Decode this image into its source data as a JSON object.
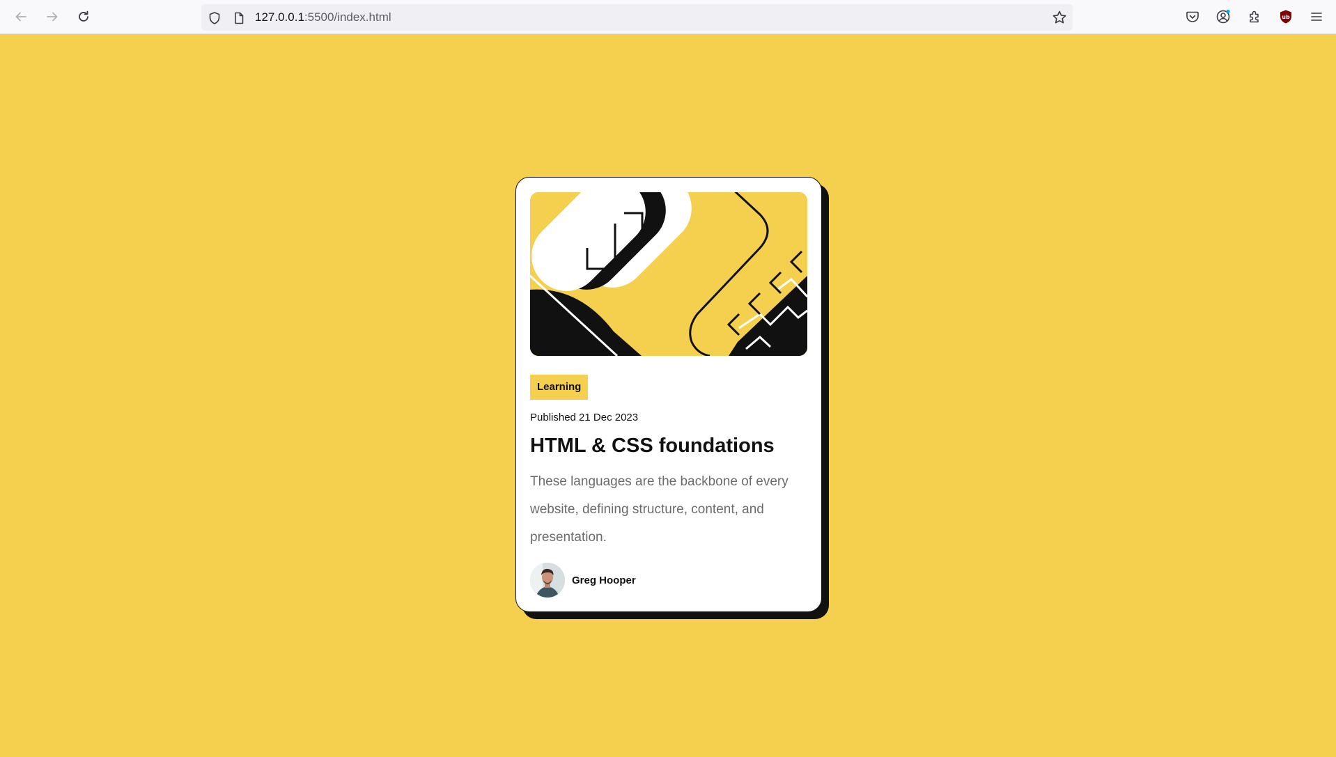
{
  "browser": {
    "url_host": "127.0.0.1",
    "url_path": ":5500/index.html"
  },
  "card": {
    "tag": "Learning",
    "published": "Published 21 Dec 2023",
    "title": "HTML & CSS foundations",
    "description": "These languages are the backbone of every website, defining structure, content, and presentation.",
    "author": "Greg Hooper"
  },
  "colors": {
    "background": "#f4d04e",
    "card": "#ffffff",
    "ink": "#111111",
    "muted_text": "#6b6b6b"
  },
  "icons": {
    "back": "arrow-left-icon",
    "forward": "arrow-right-icon",
    "reload": "reload-icon",
    "tracking": "shield-icon",
    "page": "page-icon",
    "bookmark": "star-icon",
    "pocket": "pocket-icon",
    "account": "account-icon",
    "extensions": "extensions-icon",
    "ublock": "ublock-icon",
    "menu": "hamburger-menu-icon"
  }
}
